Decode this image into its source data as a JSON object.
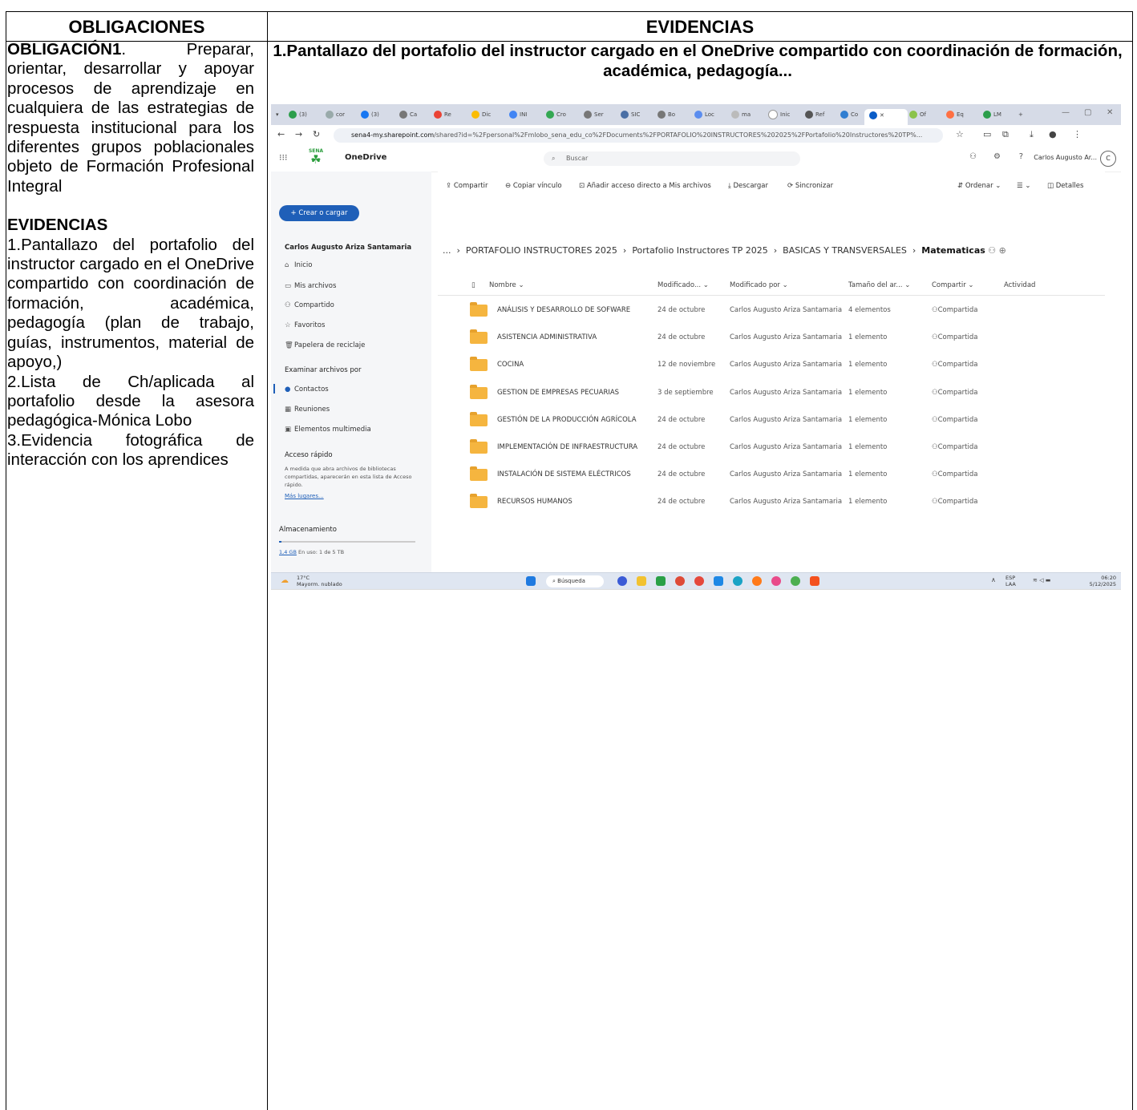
{
  "table": {
    "header_left": "OBLIGACIONES",
    "header_right": "EVIDENCIAS"
  },
  "obligation": {
    "title": "OBLIGACIÓN1",
    "text": ". Preparar, orientar, desarrollar y apoyar procesos de aprendizaje en cualquiera de las estrategias de respuesta institucional para los diferentes grupos poblacionales objeto de Formación Profesional Integral",
    "evidence_heading": "EVIDENCIAS",
    "evidence_items": [
      "1.Pantallazo del portafolio del instructor cargado en el OneDrive compartido con coordinación de formación, académica, pedagogía (plan de trabajo, guías, instrumentos, material de apoyo,)",
      "2.Lista de Ch/aplicada al portafolio desde la asesora pedagógica-Mónica Lobo",
      "3.Evidencia fotográfica de interacción con los aprendices"
    ]
  },
  "evidence_title": "1.Pantallazo del portafolio del instructor cargado en el OneDrive compartido con coordinación de formación, académica, pedagogía...",
  "screenshot": {
    "browser": {
      "tabs": [
        "(3)",
        "cor",
        "(3)",
        "Ca",
        "Re",
        "Dic",
        "INI",
        "Cro",
        "Ser",
        "SIC",
        "Bo",
        "Loc",
        "ma",
        "Inic",
        "Ref",
        "Co",
        "Of",
        "Eq",
        "LM"
      ],
      "url_host": "sena4-my.sharepoint.com",
      "url_path": "/shared?id=%2Fpersonal%2Fmlobo_sena_edu_co%2FDocuments%2FPORTAFOLIO%20INSTRUCTORES%202025%2FPortafolio%20Instructores%20TP%..."
    },
    "onedrive": {
      "brand": "OneDrive",
      "logo_text": "SENA",
      "search_placeholder": "Buscar",
      "user_name": "Carlos Augusto Ar...",
      "avatar": "C",
      "create_button": "Crear o cargar",
      "sidebar_user": "Carlos Augusto Ariza Santamaria",
      "sidebar_nav": [
        "Inicio",
        "Mis archivos",
        "Compartido",
        "Favoritos",
        "Papelera de reciclaje"
      ],
      "browse_heading": "Examinar archivos por",
      "browse_items": [
        "Contactos",
        "Reuniones",
        "Elementos multimedia"
      ],
      "quick_heading": "Acceso rápido",
      "quick_text": "A medida que abra archivos de bibliotecas compartidas, aparecerán en esta lista de Acceso rápido.",
      "quick_link": "Más lugares...",
      "storage_heading": "Almacenamiento",
      "storage_used": "1,4 GB",
      "storage_text": "En uso: 1 de 5 TB",
      "toolbar": [
        "Compartir",
        "Copiar vínculo",
        "Añadir acceso directo a Mis archivos",
        "Descargar",
        "Sincronizar"
      ],
      "toolbar_right": [
        "Ordenar",
        "Detalles"
      ],
      "breadcrumb": [
        "...",
        "PORTAFOLIO INSTRUCTORES 2025",
        "Portafolio Instructores TP 2025",
        "BASICAS Y TRANSVERSALES",
        "Matematicas"
      ],
      "columns": [
        "Nombre",
        "Modificado...",
        "Modificado por",
        "Tamaño del ar...",
        "Compartir",
        "Actividad"
      ],
      "rows": [
        {
          "name": "ANÁLISIS Y DESARROLLO DE SOFWARE",
          "modified": "24 de octubre",
          "by": "Carlos Augusto Ariza Santamaria",
          "size": "4 elementos",
          "sharing": "Compartida"
        },
        {
          "name": "ASISTENCIA ADMINISTRATIVA",
          "modified": "24 de octubre",
          "by": "Carlos Augusto Ariza Santamaria",
          "size": "1 elemento",
          "sharing": "Compartida"
        },
        {
          "name": "COCINA",
          "modified": "12 de noviembre",
          "by": "Carlos Augusto Ariza Santamaria",
          "size": "1 elemento",
          "sharing": "Compartida"
        },
        {
          "name": "GESTION DE EMPRESAS PECUARIAS",
          "modified": "3 de septiembre",
          "by": "Carlos Augusto Ariza Santamaria",
          "size": "1 elemento",
          "sharing": "Compartida"
        },
        {
          "name": "GESTIÓN DE LA PRODUCCIÓN AGRÍCOLA",
          "modified": "24 de octubre",
          "by": "Carlos Augusto Ariza Santamaria",
          "size": "1 elemento",
          "sharing": "Compartida"
        },
        {
          "name": "IMPLEMENTACIÓN DE INFRAESTRUCTURA",
          "modified": "24 de octubre",
          "by": "Carlos Augusto Ariza Santamaria",
          "size": "1 elemento",
          "sharing": "Compartida"
        },
        {
          "name": "INSTALACIÓN DE SISTEMA ELÉCTRICOS",
          "modified": "24 de octubre",
          "by": "Carlos Augusto Ariza Santamaria",
          "size": "1 elemento",
          "sharing": "Compartida"
        },
        {
          "name": "RECURSOS HUMANOS",
          "modified": "24 de octubre",
          "by": "Carlos Augusto Ariza Santamaria",
          "size": "1 elemento",
          "sharing": "Compartida"
        }
      ]
    },
    "taskbar": {
      "temperature": "17°C",
      "weather": "Mayorm. nublado",
      "search": "Búsqueda",
      "lang": "ESP",
      "lang2": "LAA",
      "time": "06:20",
      "date": "5/12/2025"
    }
  }
}
